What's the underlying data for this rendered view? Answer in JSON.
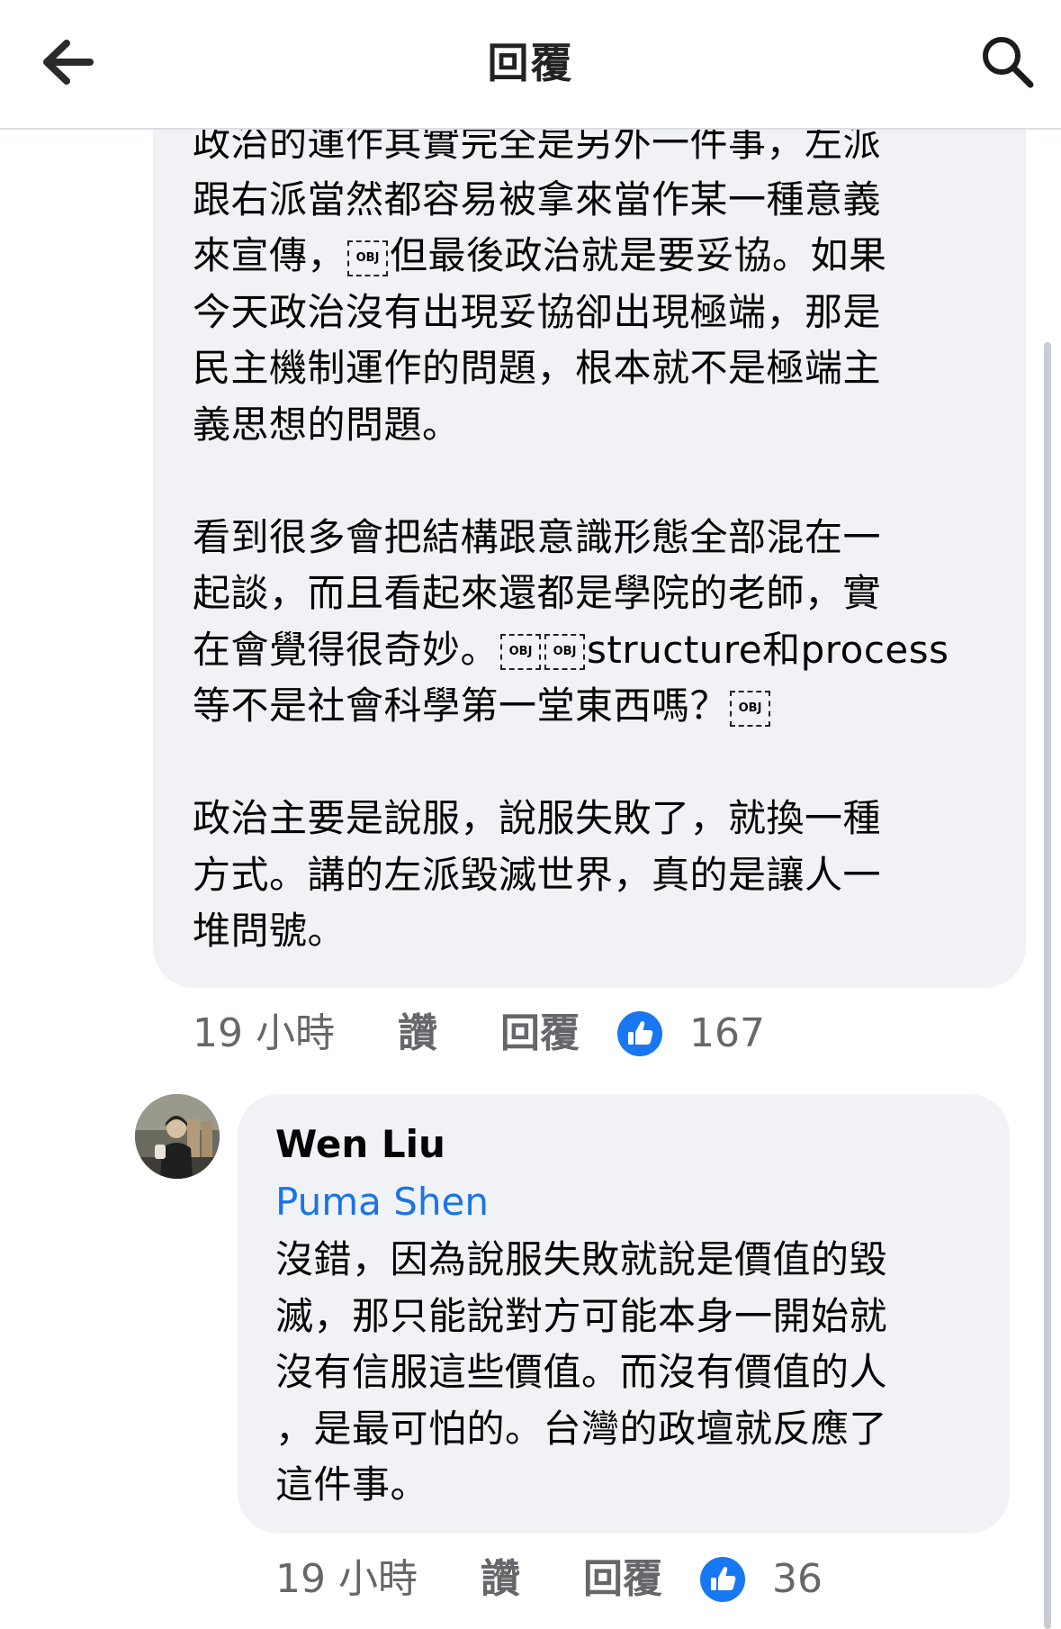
{
  "header": {
    "title": "回覆",
    "back_icon": "arrow-left-icon",
    "search_icon": "search-icon"
  },
  "comment1": {
    "paragraph1": "政治的運作其實完全是另外一件事，左派\n跟右派當然都容易被拿來當作某一種意義\n來宣傳，",
    "paragraph1b": "但最後政治就是要妥協。如果\n今天政治沒有出現妥協卻出現極端，那是\n民主機制運作的問題，根本就不是極端主\n義思想的問題。",
    "paragraph2a": "看到很多會把結構跟意識形態全部混在一\n起談，而且看起來還都是學院的老師，實\n在會覺得很奇妙。",
    "paragraph2b": "structure和process\n等不是社會科學第一堂東西嗎？",
    "paragraph3": "政治主要是說服，說服失敗了，就換一種\n方式。講的左派毀滅世界，真的是讓人一\n堆問號。",
    "obj_glyph": "OBJ",
    "time": "19 小時",
    "like_label": "讚",
    "reply_label": "回覆",
    "reaction_count": "167"
  },
  "comment2": {
    "author": "Wen Liu",
    "mention": "Puma Shen",
    "text": "沒錯，因為說服失敗就說是價值的毀\n滅，那只能說對方可能本身一開始就\n沒有信服這些價值。而沒有價值的人\n，是最可怕的。台灣的政壇就反應了\n這件事。",
    "time": "19 小時",
    "like_label": "讚",
    "reply_label": "回覆",
    "reaction_count": "36"
  },
  "colors": {
    "bubble": "#f0f2f5",
    "link": "#1b74e4",
    "like_blue": "#1877f2",
    "meta_gray": "#65676b"
  }
}
